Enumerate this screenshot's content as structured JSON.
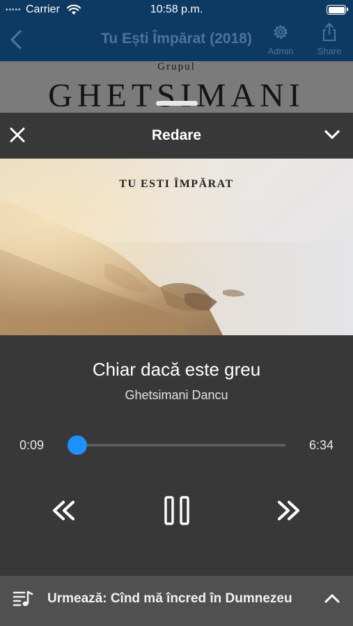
{
  "status_bar": {
    "signal": "•••••",
    "carrier": "Carrier",
    "time": "10:58 p.m."
  },
  "nav": {
    "title": "Tu Ești Împărat (2018)",
    "admin_label": "Admin",
    "share_label": "Share"
  },
  "background_cover": {
    "overline": "Grupul",
    "group_name": "GHETSIMANI"
  },
  "player": {
    "header_title": "Redare",
    "artwork_title": "TU ESTI ÎMPĂRAT",
    "song_title": "Chiar dacă este greu",
    "artist": "Ghetsimani Dancu",
    "elapsed": "0:09",
    "duration": "6:34",
    "progress_fraction": 0.023,
    "accent_color": "#1e90ff",
    "controls": {
      "rewind_icon": "rewind-icon",
      "pause_icon": "pause-icon",
      "forward_icon": "fast-forward-icon"
    }
  },
  "up_next": {
    "label": "Urmează: Cînd mă încred în Dumnezeu"
  }
}
